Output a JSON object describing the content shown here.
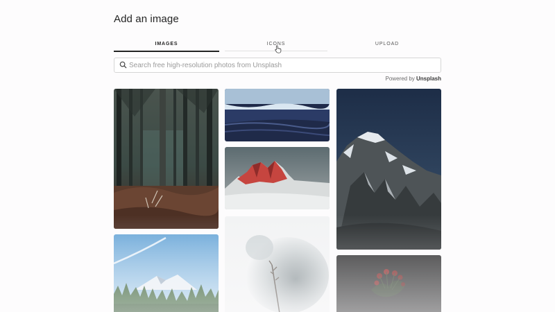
{
  "dialog": {
    "title": "Add an image"
  },
  "tabs": [
    {
      "label": "IMAGES",
      "active": true
    },
    {
      "label": "ICONS",
      "active": false
    },
    {
      "label": "UPLOAD",
      "active": false
    }
  ],
  "search": {
    "placeholder": "Search free high-resolution photos from Unsplash",
    "value": ""
  },
  "attribution": {
    "prefix": "Powered by ",
    "brand": "Unsplash"
  },
  "photos": [
    {
      "subject": "misty pine forest",
      "icon": "forest-photo"
    },
    {
      "subject": "icy lake shoreline",
      "icon": "lake-photo"
    },
    {
      "subject": "red rocky peaks in snow",
      "icon": "red-peaks-photo"
    },
    {
      "subject": "snow covered mountain",
      "icon": "mountain-photo"
    },
    {
      "subject": "snowy mountain behind trees",
      "icon": "alpine-photo"
    },
    {
      "subject": "frosted dry plant",
      "icon": "frost-plant-photo"
    },
    {
      "subject": "dark red flowers",
      "icon": "flowers-photo"
    }
  ],
  "colors": {
    "accent": "#232323",
    "tab_divider": "#e1e1e1",
    "input_border": "#d6d6d6",
    "background": "#fdfcfd"
  }
}
